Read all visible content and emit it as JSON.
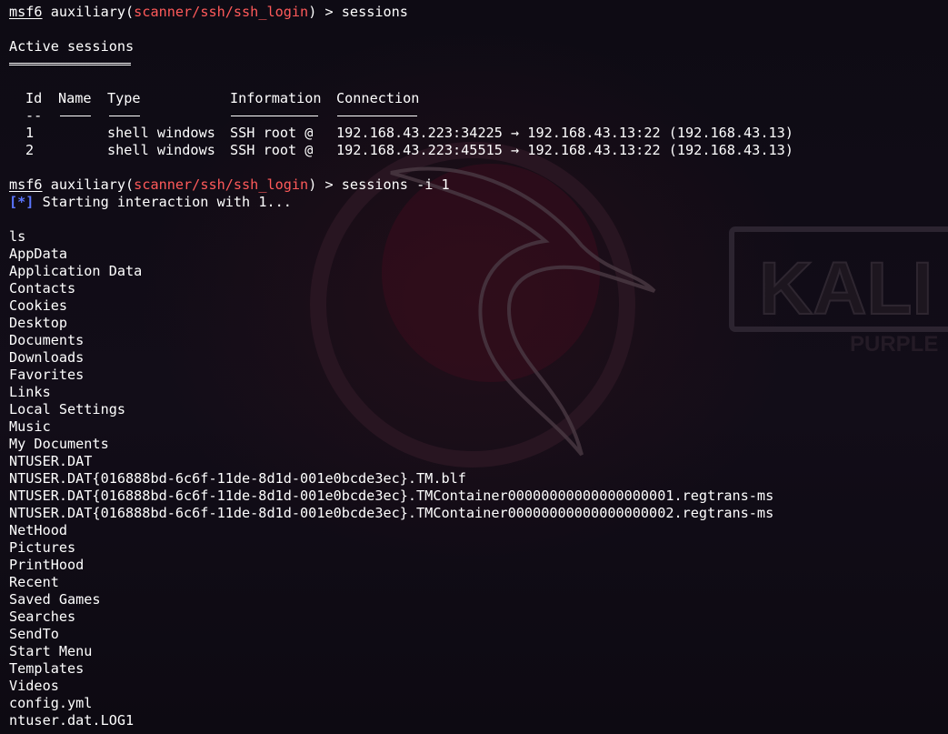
{
  "prompt": {
    "msf": "msf6",
    "module_prefix": " auxiliary(",
    "module": "scanner/ssh/ssh_login",
    "module_suffix": ") > "
  },
  "cmd1": "sessions",
  "active_title": "Active sessions",
  "table": {
    "headers": [
      "Id",
      "Name",
      "Type",
      "Information",
      "Connection"
    ],
    "header_dashes": [
      "--",
      "----",
      "----",
      "-----------",
      "----------"
    ],
    "rows": [
      {
        "id": "1",
        "name": "",
        "type": "shell windows",
        "info": "SSH root @",
        "conn": "192.168.43.223:34225 → 192.168.43.13:22 (192.168.43.13)"
      },
      {
        "id": "2",
        "name": "",
        "type": "shell windows",
        "info": "SSH root @",
        "conn": "192.168.43.223:45515 → 192.168.43.13:22 (192.168.43.13)"
      }
    ]
  },
  "cmd2": "sessions -i 1",
  "status": {
    "marker": "[*]",
    "text": " Starting interaction with 1..."
  },
  "cmd3": "ls",
  "listing": [
    "AppData",
    "Application Data",
    "Contacts",
    "Cookies",
    "Desktop",
    "Documents",
    "Downloads",
    "Favorites",
    "Links",
    "Local Settings",
    "Music",
    "My Documents",
    "NTUSER.DAT",
    "NTUSER.DAT{016888bd-6c6f-11de-8d1d-001e0bcde3ec}.TM.blf",
    "NTUSER.DAT{016888bd-6c6f-11de-8d1d-001e0bcde3ec}.TMContainer00000000000000000001.regtrans-ms",
    "NTUSER.DAT{016888bd-6c6f-11de-8d1d-001e0bcde3ec}.TMContainer00000000000000000002.regtrans-ms",
    "NetHood",
    "Pictures",
    "PrintHood",
    "Recent",
    "Saved Games",
    "Searches",
    "SendTo",
    "Start Menu",
    "Templates",
    "Videos",
    "config.yml",
    "ntuser.dat.LOG1"
  ],
  "wallpaper": {
    "brand": "KALI",
    "sub": "PURPLE",
    "accent": "#6a0f2a"
  }
}
